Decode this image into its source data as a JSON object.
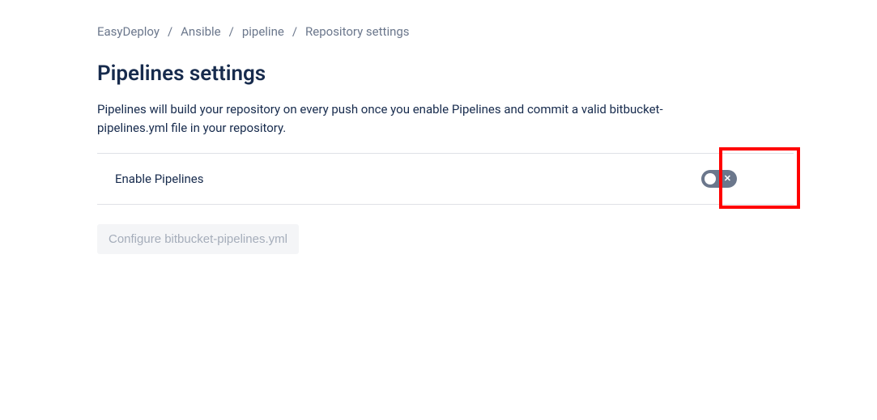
{
  "breadcrumb": {
    "items": [
      "EasyDeploy",
      "Ansible",
      "pipeline",
      "Repository settings"
    ]
  },
  "page": {
    "title": "Pipelines settings",
    "description": "Pipelines will build your repository on every push once you enable Pipelines and commit a valid bitbucket-pipelines.yml file in your repository."
  },
  "setting": {
    "enable_label": "Enable Pipelines",
    "toggle_state": "off",
    "toggle_icon": "✕"
  },
  "actions": {
    "configure_label": "Configure bitbucket-pipelines.yml"
  }
}
